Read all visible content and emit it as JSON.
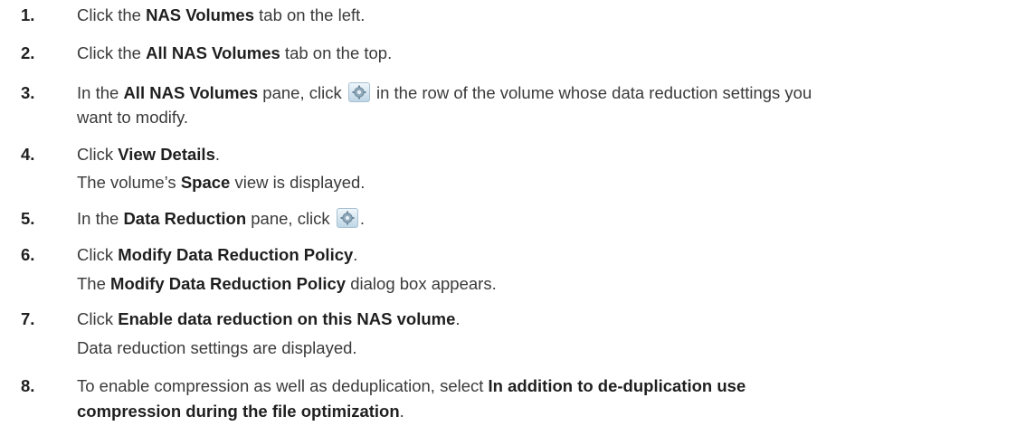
{
  "steps": [
    {
      "num": "1.",
      "lines": [
        [
          "Click the ",
          {
            "b": "NAS Volumes"
          },
          " tab on the left."
        ]
      ]
    },
    {
      "num": "2.",
      "lines": [
        [
          "Click the ",
          {
            "b": "All NAS Volumes"
          },
          " tab on the top."
        ]
      ]
    },
    {
      "num": "3.",
      "lines": [
        [
          "In the ",
          {
            "b": "All NAS Volumes"
          },
          " pane, click ",
          {
            "icon": "gear-icon"
          },
          " in the row of the volume whose data reduction settings you"
        ],
        [
          "want to modify."
        ]
      ]
    },
    {
      "num": "4.",
      "lines": [
        [
          "Click ",
          {
            "b": "View Details"
          },
          "."
        ],
        [
          "The volume’s ",
          {
            "b": "Space"
          },
          " view is displayed."
        ]
      ]
    },
    {
      "num": "5.",
      "lines": [
        [
          "In the ",
          {
            "b": "Data Reduction"
          },
          " pane, click ",
          {
            "icon": "gear-icon"
          },
          "."
        ]
      ]
    },
    {
      "num": "6.",
      "lines": [
        [
          "Click ",
          {
            "b": "Modify Data Reduction Policy"
          },
          "."
        ],
        [
          "The ",
          {
            "b": "Modify Data Reduction Policy"
          },
          " dialog box appears."
        ]
      ]
    },
    {
      "num": "7.",
      "lines": [
        [
          "Click ",
          {
            "b": "Enable data reduction on this NAS volume"
          },
          "."
        ],
        [
          "Data reduction settings are displayed."
        ]
      ]
    },
    {
      "num": "8.",
      "lines": [
        [
          "To enable compression as well as deduplication, select ",
          {
            "b": "In addition to de-duplication use"
          }
        ],
        [
          {
            "b": "compression during the file optimization"
          },
          "."
        ]
      ]
    }
  ]
}
